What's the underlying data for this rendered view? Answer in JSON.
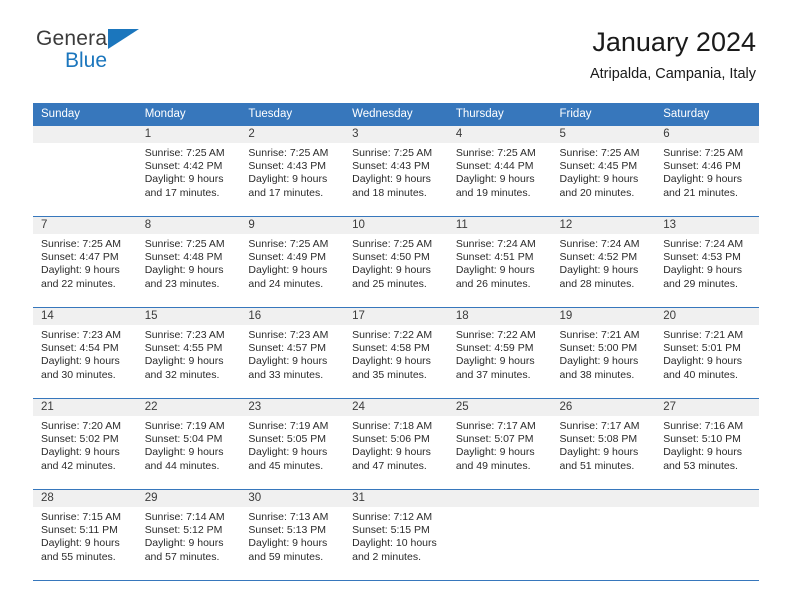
{
  "brand": {
    "name_top": "General",
    "name_bottom": "Blue",
    "accent_color": "#1b76bd"
  },
  "header": {
    "title": "January 2024",
    "subtitle": "Atripalda, Campania, Italy"
  },
  "calendar": {
    "header_color": "#3777bc",
    "daynum_bg": "#f0f0f0",
    "weekday_headers": [
      "Sunday",
      "Monday",
      "Tuesday",
      "Wednesday",
      "Thursday",
      "Friday",
      "Saturday"
    ],
    "weeks": [
      [
        {
          "day": "",
          "sunrise": "",
          "sunset": "",
          "daylight1": "",
          "daylight2": ""
        },
        {
          "day": "1",
          "sunrise": "Sunrise: 7:25 AM",
          "sunset": "Sunset: 4:42 PM",
          "daylight1": "Daylight: 9 hours",
          "daylight2": "and 17 minutes."
        },
        {
          "day": "2",
          "sunrise": "Sunrise: 7:25 AM",
          "sunset": "Sunset: 4:43 PM",
          "daylight1": "Daylight: 9 hours",
          "daylight2": "and 17 minutes."
        },
        {
          "day": "3",
          "sunrise": "Sunrise: 7:25 AM",
          "sunset": "Sunset: 4:43 PM",
          "daylight1": "Daylight: 9 hours",
          "daylight2": "and 18 minutes."
        },
        {
          "day": "4",
          "sunrise": "Sunrise: 7:25 AM",
          "sunset": "Sunset: 4:44 PM",
          "daylight1": "Daylight: 9 hours",
          "daylight2": "and 19 minutes."
        },
        {
          "day": "5",
          "sunrise": "Sunrise: 7:25 AM",
          "sunset": "Sunset: 4:45 PM",
          "daylight1": "Daylight: 9 hours",
          "daylight2": "and 20 minutes."
        },
        {
          "day": "6",
          "sunrise": "Sunrise: 7:25 AM",
          "sunset": "Sunset: 4:46 PM",
          "daylight1": "Daylight: 9 hours",
          "daylight2": "and 21 minutes."
        }
      ],
      [
        {
          "day": "7",
          "sunrise": "Sunrise: 7:25 AM",
          "sunset": "Sunset: 4:47 PM",
          "daylight1": "Daylight: 9 hours",
          "daylight2": "and 22 minutes."
        },
        {
          "day": "8",
          "sunrise": "Sunrise: 7:25 AM",
          "sunset": "Sunset: 4:48 PM",
          "daylight1": "Daylight: 9 hours",
          "daylight2": "and 23 minutes."
        },
        {
          "day": "9",
          "sunrise": "Sunrise: 7:25 AM",
          "sunset": "Sunset: 4:49 PM",
          "daylight1": "Daylight: 9 hours",
          "daylight2": "and 24 minutes."
        },
        {
          "day": "10",
          "sunrise": "Sunrise: 7:25 AM",
          "sunset": "Sunset: 4:50 PM",
          "daylight1": "Daylight: 9 hours",
          "daylight2": "and 25 minutes."
        },
        {
          "day": "11",
          "sunrise": "Sunrise: 7:24 AM",
          "sunset": "Sunset: 4:51 PM",
          "daylight1": "Daylight: 9 hours",
          "daylight2": "and 26 minutes."
        },
        {
          "day": "12",
          "sunrise": "Sunrise: 7:24 AM",
          "sunset": "Sunset: 4:52 PM",
          "daylight1": "Daylight: 9 hours",
          "daylight2": "and 28 minutes."
        },
        {
          "day": "13",
          "sunrise": "Sunrise: 7:24 AM",
          "sunset": "Sunset: 4:53 PM",
          "daylight1": "Daylight: 9 hours",
          "daylight2": "and 29 minutes."
        }
      ],
      [
        {
          "day": "14",
          "sunrise": "Sunrise: 7:23 AM",
          "sunset": "Sunset: 4:54 PM",
          "daylight1": "Daylight: 9 hours",
          "daylight2": "and 30 minutes."
        },
        {
          "day": "15",
          "sunrise": "Sunrise: 7:23 AM",
          "sunset": "Sunset: 4:55 PM",
          "daylight1": "Daylight: 9 hours",
          "daylight2": "and 32 minutes."
        },
        {
          "day": "16",
          "sunrise": "Sunrise: 7:23 AM",
          "sunset": "Sunset: 4:57 PM",
          "daylight1": "Daylight: 9 hours",
          "daylight2": "and 33 minutes."
        },
        {
          "day": "17",
          "sunrise": "Sunrise: 7:22 AM",
          "sunset": "Sunset: 4:58 PM",
          "daylight1": "Daylight: 9 hours",
          "daylight2": "and 35 minutes."
        },
        {
          "day": "18",
          "sunrise": "Sunrise: 7:22 AM",
          "sunset": "Sunset: 4:59 PM",
          "daylight1": "Daylight: 9 hours",
          "daylight2": "and 37 minutes."
        },
        {
          "day": "19",
          "sunrise": "Sunrise: 7:21 AM",
          "sunset": "Sunset: 5:00 PM",
          "daylight1": "Daylight: 9 hours",
          "daylight2": "and 38 minutes."
        },
        {
          "day": "20",
          "sunrise": "Sunrise: 7:21 AM",
          "sunset": "Sunset: 5:01 PM",
          "daylight1": "Daylight: 9 hours",
          "daylight2": "and 40 minutes."
        }
      ],
      [
        {
          "day": "21",
          "sunrise": "Sunrise: 7:20 AM",
          "sunset": "Sunset: 5:02 PM",
          "daylight1": "Daylight: 9 hours",
          "daylight2": "and 42 minutes."
        },
        {
          "day": "22",
          "sunrise": "Sunrise: 7:19 AM",
          "sunset": "Sunset: 5:04 PM",
          "daylight1": "Daylight: 9 hours",
          "daylight2": "and 44 minutes."
        },
        {
          "day": "23",
          "sunrise": "Sunrise: 7:19 AM",
          "sunset": "Sunset: 5:05 PM",
          "daylight1": "Daylight: 9 hours",
          "daylight2": "and 45 minutes."
        },
        {
          "day": "24",
          "sunrise": "Sunrise: 7:18 AM",
          "sunset": "Sunset: 5:06 PM",
          "daylight1": "Daylight: 9 hours",
          "daylight2": "and 47 minutes."
        },
        {
          "day": "25",
          "sunrise": "Sunrise: 7:17 AM",
          "sunset": "Sunset: 5:07 PM",
          "daylight1": "Daylight: 9 hours",
          "daylight2": "and 49 minutes."
        },
        {
          "day": "26",
          "sunrise": "Sunrise: 7:17 AM",
          "sunset": "Sunset: 5:08 PM",
          "daylight1": "Daylight: 9 hours",
          "daylight2": "and 51 minutes."
        },
        {
          "day": "27",
          "sunrise": "Sunrise: 7:16 AM",
          "sunset": "Sunset: 5:10 PM",
          "daylight1": "Daylight: 9 hours",
          "daylight2": "and 53 minutes."
        }
      ],
      [
        {
          "day": "28",
          "sunrise": "Sunrise: 7:15 AM",
          "sunset": "Sunset: 5:11 PM",
          "daylight1": "Daylight: 9 hours",
          "daylight2": "and 55 minutes."
        },
        {
          "day": "29",
          "sunrise": "Sunrise: 7:14 AM",
          "sunset": "Sunset: 5:12 PM",
          "daylight1": "Daylight: 9 hours",
          "daylight2": "and 57 minutes."
        },
        {
          "day": "30",
          "sunrise": "Sunrise: 7:13 AM",
          "sunset": "Sunset: 5:13 PM",
          "daylight1": "Daylight: 9 hours",
          "daylight2": "and 59 minutes."
        },
        {
          "day": "31",
          "sunrise": "Sunrise: 7:12 AM",
          "sunset": "Sunset: 5:15 PM",
          "daylight1": "Daylight: 10 hours",
          "daylight2": "and 2 minutes."
        },
        {
          "day": "",
          "sunrise": "",
          "sunset": "",
          "daylight1": "",
          "daylight2": ""
        },
        {
          "day": "",
          "sunrise": "",
          "sunset": "",
          "daylight1": "",
          "daylight2": ""
        },
        {
          "day": "",
          "sunrise": "",
          "sunset": "",
          "daylight1": "",
          "daylight2": ""
        }
      ]
    ]
  }
}
